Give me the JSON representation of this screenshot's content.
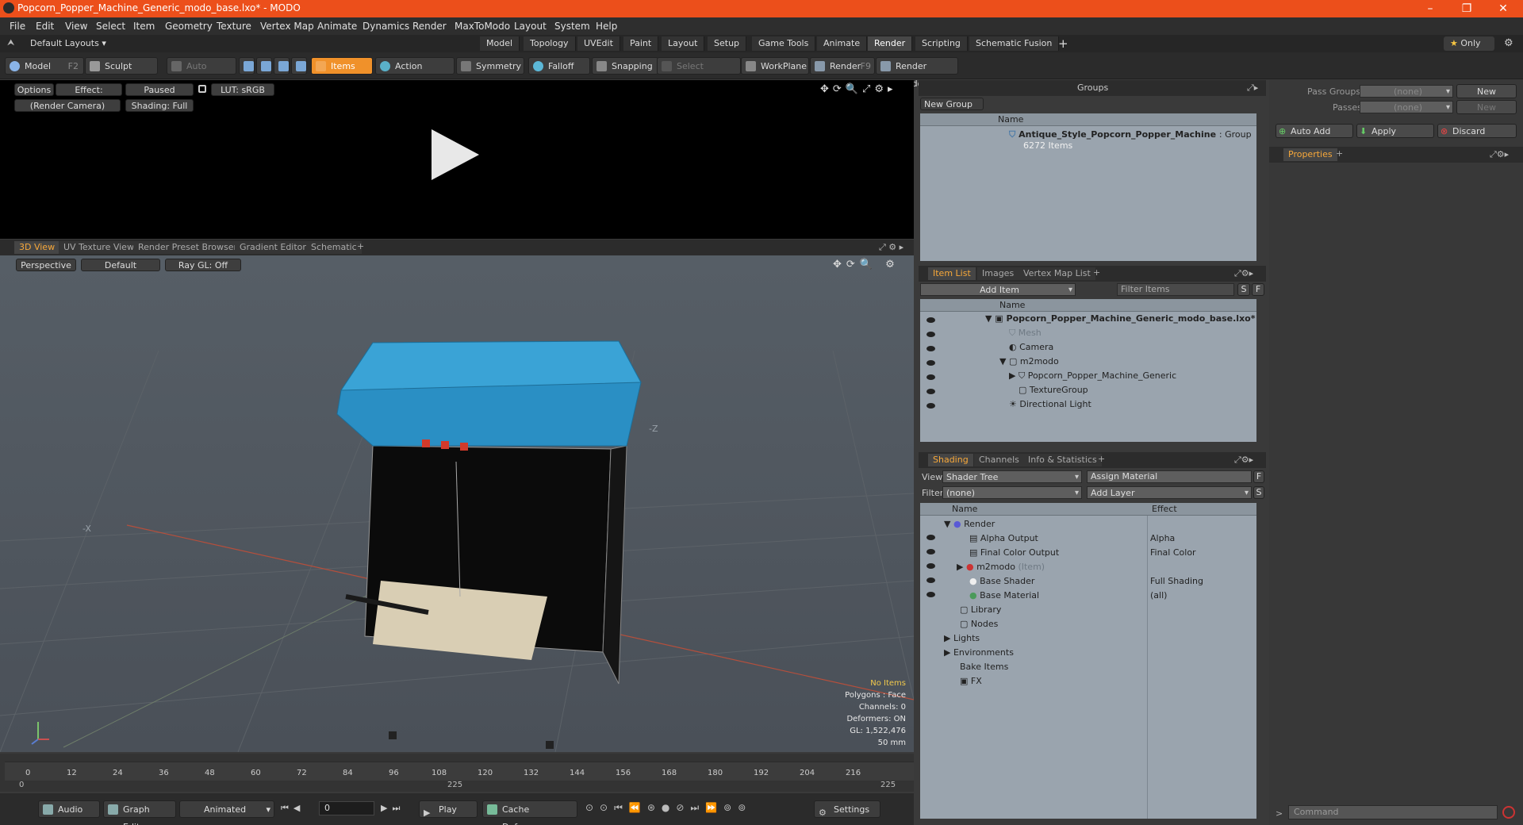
{
  "window": {
    "title": "Popcorn_Popper_Machine_Generic_modo_base.lxo* - MODO"
  },
  "menu": [
    "File",
    "Edit",
    "View",
    "Select",
    "Item",
    "Geometry",
    "Texture",
    "Vertex Map",
    "Animate",
    "Dynamics",
    "Render",
    "MaxToModo",
    "Layout",
    "System",
    "Help"
  ],
  "layout": {
    "preset": "Default Layouts",
    "tabs": [
      "Model",
      "Topology",
      "UVEdit",
      "Paint",
      "Layout",
      "Setup",
      "Game Tools",
      "Animate",
      "Render",
      "Scripting",
      "Schematic Fusion"
    ],
    "active_tab": "Render",
    "only_label": "Only"
  },
  "toolbar": {
    "model": "Model",
    "model_key": "F2",
    "sculpt": "Sculpt",
    "auto_select": "Auto Select",
    "items": "Items",
    "action_center": "Action Center",
    "symmetry": "Symmetry",
    "falloff": "Falloff",
    "snapping": "Snapping",
    "select_through": "Select Through",
    "workplane": "WorkPlane",
    "render": "Render",
    "render_key": "F9",
    "render_window": "Render Window"
  },
  "preview": {
    "options": "Options",
    "effect": "Effect: (Shadi...",
    "paused": "Paused",
    "lut": "LUT: sRGB",
    "camera": "(Render Camera)",
    "shading": "Shading: Full"
  },
  "viewport": {
    "tabs": [
      "3D View",
      "UV Texture View",
      "Render Preset Browser",
      "Gradient Editor",
      "Schematic"
    ],
    "active_tab": "3D View",
    "perspective": "Perspective",
    "default": "Default",
    "raygl": "Ray GL: Off",
    "axis_z": "-Z",
    "axis_x": "-X",
    "stats": {
      "items": "No Items",
      "polygons": "Polygons : Face",
      "channels": "Channels: 0",
      "deformers": "Deformers: ON",
      "gl": "GL: 1,522,476",
      "focal": "50 mm"
    }
  },
  "timeline": {
    "ticks": [
      "0",
      "12",
      "24",
      "36",
      "48",
      "60",
      "72",
      "84",
      "96",
      "108",
      "120",
      "132",
      "144",
      "156",
      "168",
      "180",
      "192",
      "204",
      "216"
    ],
    "start": "0",
    "end": "225",
    "end_top": "225"
  },
  "bottombar": {
    "audio": "Audio",
    "graph_editor": "Graph Editor",
    "animated": "Animated",
    "frame": "0",
    "play": "Play",
    "cache": "Cache Deformers",
    "settings": "Settings"
  },
  "groups": {
    "title": "Groups",
    "new_group": "New Group",
    "col_name": "Name",
    "item_name": "Antique_Style_Popcorn_Popper_Machine",
    "item_type": ": Group",
    "item_count": "6272 Items"
  },
  "itemlist": {
    "tabs": [
      "Item List",
      "Images",
      "Vertex Map List"
    ],
    "add_item": "Add Item",
    "filter_placeholder": "Filter Items",
    "col_name": "Name",
    "rows": [
      "Popcorn_Popper_Machine_Generic_modo_base.lxo*",
      "Mesh",
      "Camera",
      "m2modo",
      "Popcorn_Popper_Machine_Generic",
      "TextureGroup",
      "Directional Light"
    ]
  },
  "shading": {
    "tabs": [
      "Shading",
      "Channels",
      "Info & Statistics"
    ],
    "view_label": "View",
    "view_value": "Shader Tree",
    "assign": "Assign Material",
    "filter_label": "Filter",
    "filter_value": "(none)",
    "add_layer": "Add Layer",
    "col_name": "Name",
    "col_effect": "Effect",
    "rows": [
      {
        "name": "Render",
        "effect": ""
      },
      {
        "name": "Alpha Output",
        "effect": "Alpha"
      },
      {
        "name": "Final Color Output",
        "effect": "Final Color"
      },
      {
        "name": "m2modo",
        "effect": ""
      },
      {
        "name": "Base Shader",
        "effect": "Full Shading"
      },
      {
        "name": "Base Material",
        "effect": "(all)"
      },
      {
        "name": "Library",
        "effect": ""
      },
      {
        "name": "Nodes",
        "effect": ""
      },
      {
        "name": "Lights",
        "effect": ""
      },
      {
        "name": "Environments",
        "effect": ""
      },
      {
        "name": "Bake Items",
        "effect": ""
      },
      {
        "name": "FX",
        "effect": ""
      }
    ],
    "m2modo_suffix": "(Item)"
  },
  "props": {
    "pass_groups": "Pass Groups",
    "passes": "Passes",
    "none": "(none)",
    "new": "New",
    "auto_add": "Auto Add",
    "apply": "Apply",
    "discard": "Discard",
    "properties_tab": "Properties",
    "command_placeholder": "Command"
  }
}
